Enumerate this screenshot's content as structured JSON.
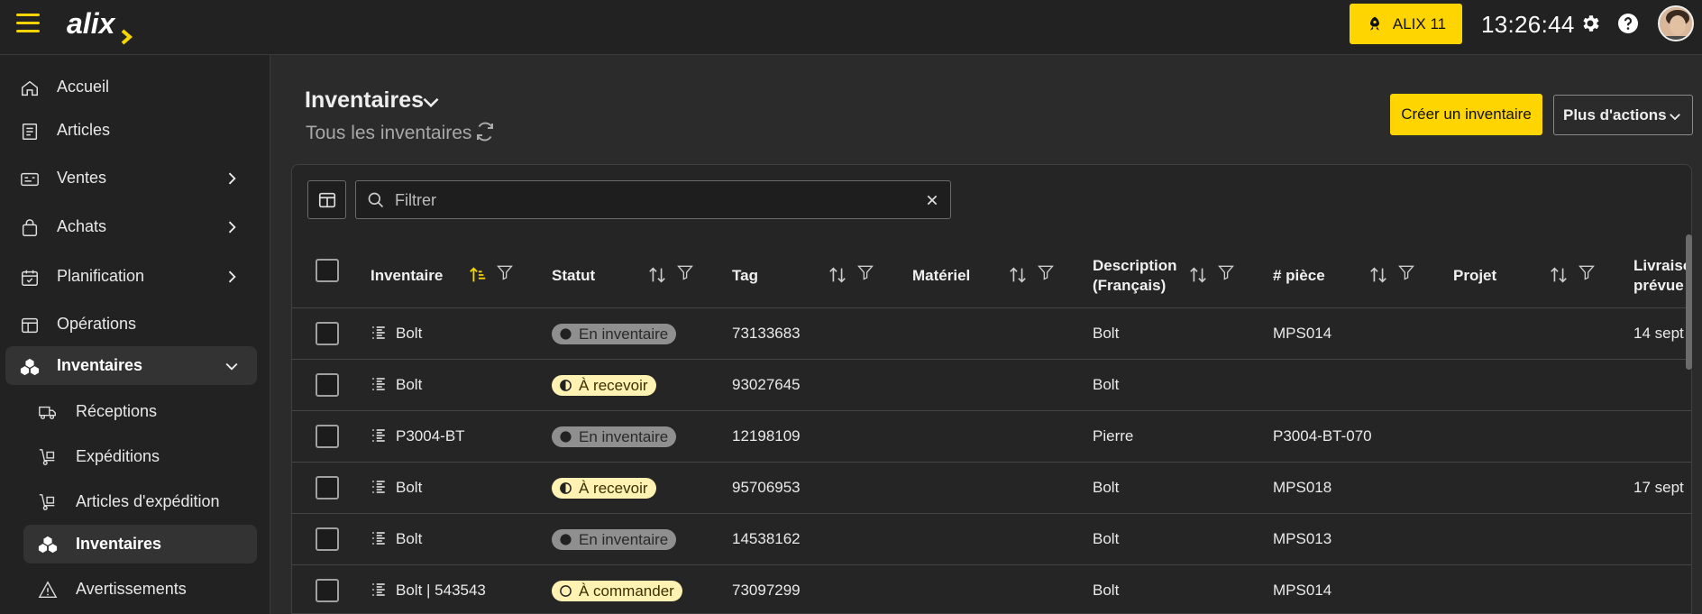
{
  "app": {
    "logo_text": "alix",
    "version_button": "ALIX 11",
    "clock": "13:26:44"
  },
  "sidebar": {
    "items": [
      {
        "label": "Accueil",
        "icon": "home-icon"
      },
      {
        "label": "Articles",
        "icon": "book-icon"
      },
      {
        "label": "Ventes",
        "icon": "card-icon"
      },
      {
        "label": "Achats",
        "icon": "bag-icon"
      },
      {
        "label": "Planification",
        "icon": "calendar-icon"
      },
      {
        "label": "Opérations",
        "icon": "layout-icon"
      },
      {
        "label": "Inventaires",
        "icon": "cubes-icon"
      }
    ],
    "sub_items": [
      {
        "label": "Réceptions",
        "icon": "truck-icon"
      },
      {
        "label": "Expéditions",
        "icon": "dolly-icon"
      },
      {
        "label": "Articles d'expédition",
        "icon": "dolly-icon"
      },
      {
        "label": "Inventaires",
        "icon": "cubes-icon"
      },
      {
        "label": "Avertissements",
        "icon": "warning-icon"
      }
    ]
  },
  "page": {
    "title": "Inventaires",
    "subtitle": "Tous les inventaires",
    "create_button": "Créer un inventaire",
    "more_button": "Plus d'actions"
  },
  "filter": {
    "placeholder": "Filtrer"
  },
  "table": {
    "columns": [
      "Inventaire",
      "Statut",
      "Tag",
      "Matériel",
      "Description (Français)",
      "# pièce",
      "Projet",
      "Livraison prévue"
    ],
    "columns_display": {
      "inventaire": "Inventaire",
      "statut": "Statut",
      "tag": "Tag",
      "materiel": "Matériel",
      "desc_1": "Description",
      "desc_2": "(Français)",
      "piece": "# pièce",
      "projet": "Projet",
      "livr_1": "Livraison",
      "livr_2": "prévue"
    },
    "rows": [
      {
        "inventaire": "Bolt",
        "statut": "En inventaire",
        "statut_style": "gray",
        "tag": "73133683",
        "materiel": "",
        "description": "Bolt",
        "piece": "MPS014",
        "projet": "",
        "livraison": "14 sept"
      },
      {
        "inventaire": "Bolt",
        "statut": "À recevoir",
        "statut_style": "yellow-half",
        "tag": "93027645",
        "materiel": "",
        "description": "Bolt",
        "piece": "",
        "projet": "",
        "livraison": ""
      },
      {
        "inventaire": "P3004-BT",
        "statut": "En inventaire",
        "statut_style": "gray",
        "tag": "12198109",
        "materiel": "",
        "description": "Pierre",
        "piece": "P3004-BT-070",
        "projet": "",
        "livraison": ""
      },
      {
        "inventaire": "Bolt",
        "statut": "À recevoir",
        "statut_style": "yellow-half",
        "tag": "95706953",
        "materiel": "",
        "description": "Bolt",
        "piece": "MPS018",
        "projet": "",
        "livraison": "17 sept"
      },
      {
        "inventaire": "Bolt",
        "statut": "En inventaire",
        "statut_style": "gray",
        "tag": "14538162",
        "materiel": "",
        "description": "Bolt",
        "piece": "MPS013",
        "projet": "",
        "livraison": ""
      },
      {
        "inventaire": "Bolt | 543543",
        "statut": "À commander",
        "statut_style": "yellow-empty",
        "tag": "73097299",
        "materiel": "",
        "description": "Bolt",
        "piece": "MPS014",
        "projet": "",
        "livraison": ""
      }
    ]
  },
  "colors": {
    "accent": "#ffd500",
    "background": "#2b2b2b",
    "sidebar": "#222222"
  }
}
